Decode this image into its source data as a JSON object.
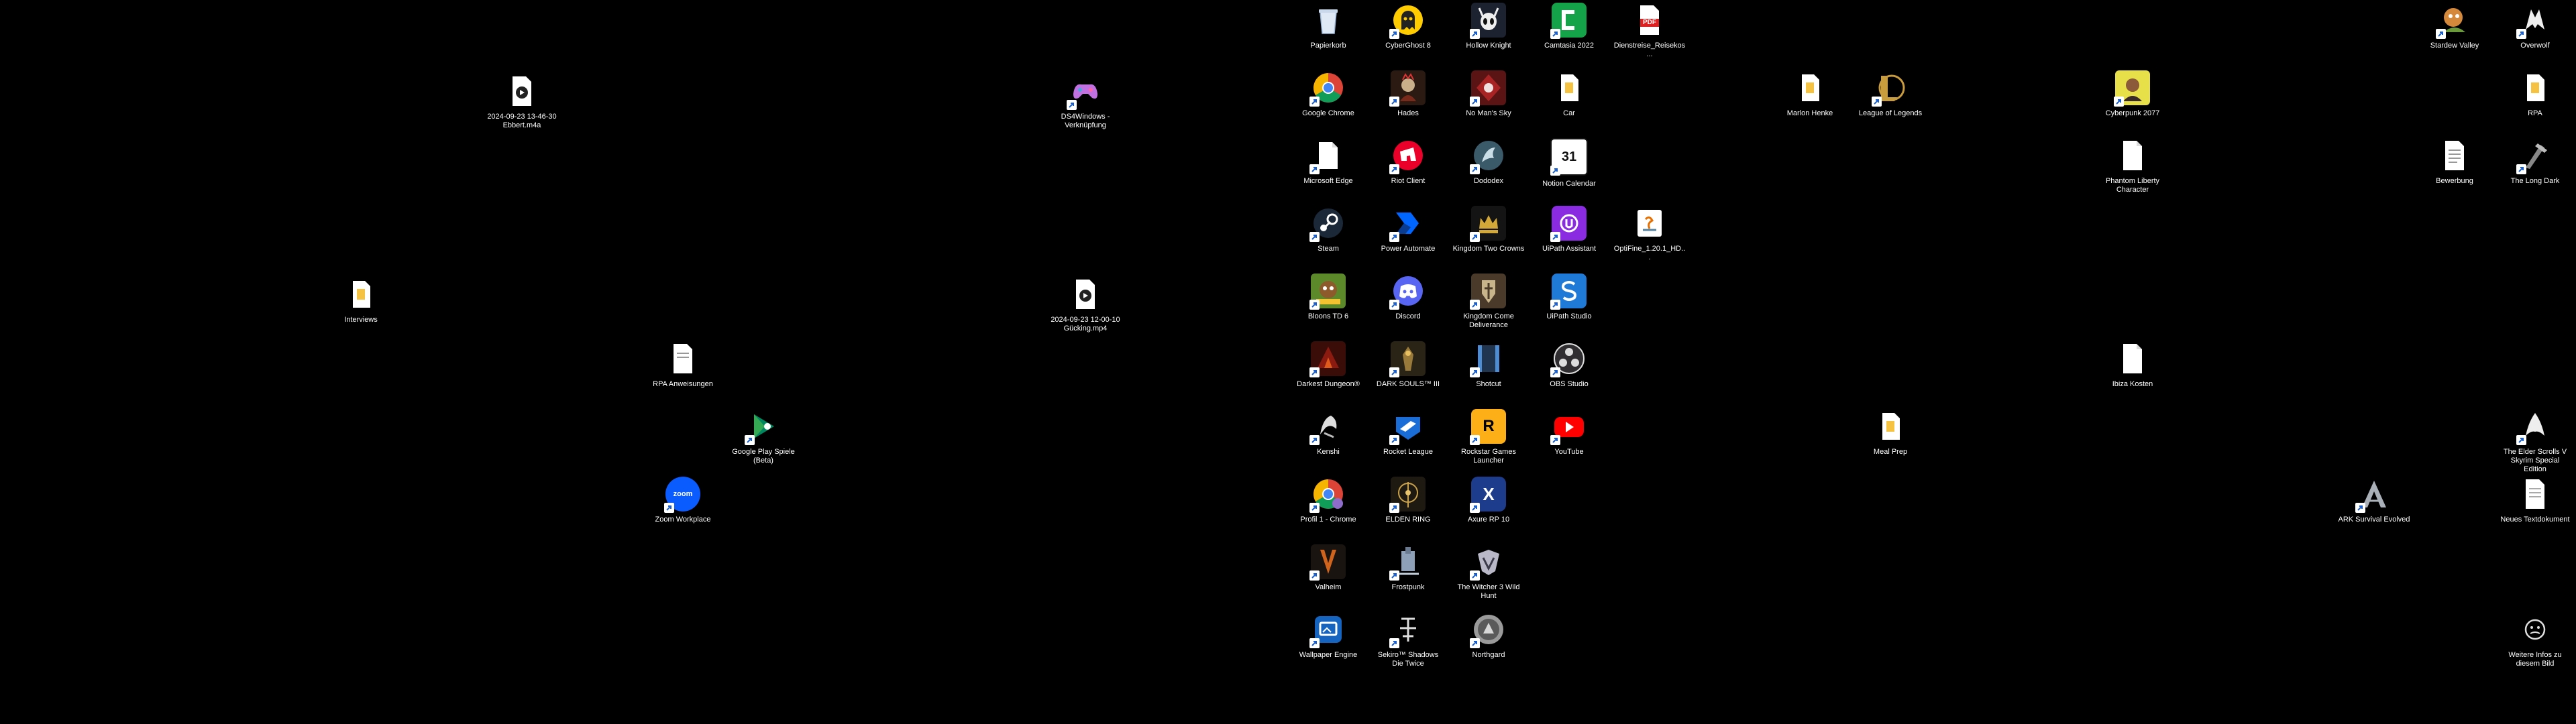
{
  "desktop": {
    "icons": {
      "papierkorb": "Papierkorb",
      "cyberghost": "CyberGhost 8",
      "hollow_knight": "Hollow Knight",
      "camtasia": "Camtasia 2022",
      "dienstreise": "Dienstreise_Reisekos...",
      "stardew": "Stardew Valley",
      "overwolf": "Overwolf",
      "m4a_file": "2024-09-23 13-46-30 Ebbert.m4a",
      "ds4windows": "DS4Windows - Verknüpfung",
      "chrome": "Google Chrome",
      "hades": "Hades",
      "nomanssky": "No Man's Sky",
      "car": "Car",
      "marlon": "Marlon Henke",
      "lol": "League of Legends",
      "cyberpunk": "Cyberpunk 2077",
      "rpa_top": "RPA",
      "edge": "Microsoft Edge",
      "riot": "Riot Client",
      "dododex": "Dododex",
      "notion_cal": "Notion Calendar",
      "phantom": "Phantom Liberty Character",
      "bewerbung": "Bewerbung",
      "longdark": "The Long Dark",
      "steam": "Steam",
      "power_automate": "Power Automate",
      "kingdom_crowns": "Kingdom Two Crowns",
      "uipath_assistant": "UiPath Assistant",
      "optifine": "OptiFine_1.20.1_HD...",
      "interviews": "Interviews",
      "mp4_file": "2024-09-23 12-00-10 Gücking.mp4",
      "bloons": "Bloons TD 6",
      "discord": "Discord",
      "kcd": "Kingdom Come Deliverance",
      "uipath_studio": "UiPath Studio",
      "rpa_anw": "RPA Anweisungen",
      "darkest": "Darkest Dungeon®",
      "darksouls": "DARK SOULS™ III",
      "shotcut": "Shotcut",
      "obs": "OBS Studio",
      "ibiza": "Ibiza Kosten",
      "gplay": "Google Play Spiele (Beta)",
      "kenshi": "Kenshi",
      "rocket": "Rocket League",
      "rockstar": "Rockstar Games Launcher",
      "youtube": "YouTube",
      "mealprep": "Meal Prep",
      "skyrim": "The Elder Scrolls V Skyrim Special Edition",
      "zoom": "Zoom Workplace",
      "profil1": "Profil 1 - Chrome",
      "eldenring": "ELDEN RING",
      "axure": "Axure RP 10",
      "ark": "ARK Survival Evolved",
      "neues_text": "Neues Textdokument",
      "valheim": "Valheim",
      "frostpunk": "Frostpunk",
      "witcher": "The Witcher 3 Wild Hunt",
      "wallpaper": "Wallpaper Engine",
      "sekiro": "Sekiro™ Shadows Die Twice",
      "northgard": "Northgard",
      "weitere": "Weitere Infos zu diesem Bild"
    },
    "glyph_text": {
      "pdf": "PDF",
      "notion_num": "31",
      "uipath": "Ui",
      "zoom": "zoom",
      "rockstar": "R",
      "axure": "X"
    }
  }
}
